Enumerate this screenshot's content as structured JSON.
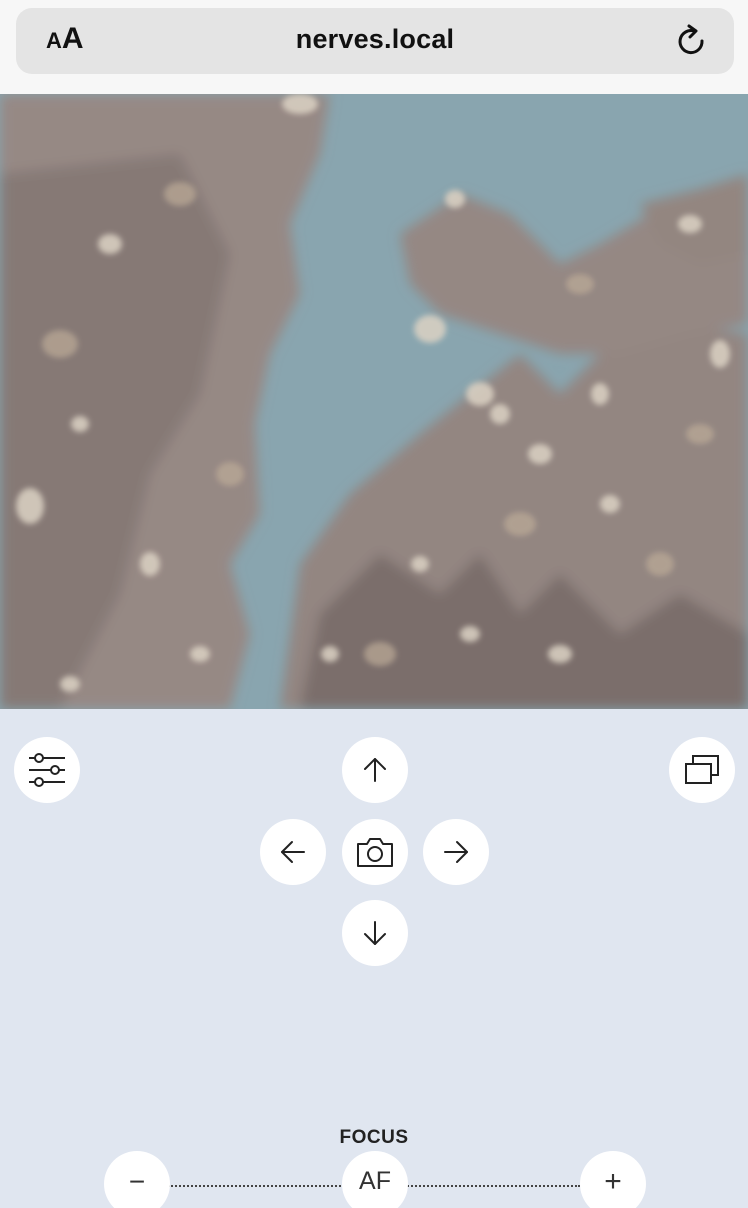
{
  "browser": {
    "reader_small": "A",
    "reader_big": "A",
    "url": "nerves.local",
    "reload_icon": "reload-icon"
  },
  "camera": {
    "icon": "camera-image"
  },
  "controls": {
    "settings_icon": "sliders-icon",
    "up_icon": "arrow-up-icon",
    "left_icon": "arrow-left-icon",
    "capture_icon": "camera-icon",
    "right_icon": "arrow-right-icon",
    "down_icon": "arrow-down-icon",
    "windows_icon": "windows-icon"
  },
  "focus": {
    "label": "FOCUS",
    "minus_label": "−",
    "af_label": "AF",
    "plus_label": "+"
  }
}
